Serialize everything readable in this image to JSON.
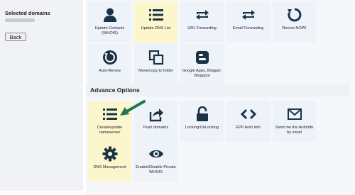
{
  "sidebar": {
    "title": "Selected domains",
    "back_label": "Back"
  },
  "tiles": [
    {
      "label": "Update Contacts (WHOIS)",
      "icon": "user-icon"
    },
    {
      "label": "Update DNS List",
      "icon": "list-icon"
    },
    {
      "label": "URL Forwarding",
      "icon": "forward-arrows-icon"
    },
    {
      "label": "Email Forwarding",
      "icon": "forward-arrows-icon"
    },
    {
      "label": "Renew NOW!",
      "icon": "renew-icon"
    },
    {
      "label": "Auto-Renew",
      "icon": "auto-renew-icon"
    },
    {
      "label": "Move/copy to folder",
      "icon": "copy-icon"
    },
    {
      "label": "Google Apps, Blogger, Blogspot",
      "icon": "blogger-icon"
    }
  ],
  "advance": {
    "title": "Advance Options",
    "tiles": [
      {
        "label": "Create/update nameserver",
        "icon": "list-icon"
      },
      {
        "label": "Push domains",
        "icon": "share-icon"
      },
      {
        "label": "Locking/UnLocking",
        "icon": "lock-icon"
      },
      {
        "label": "EPP Auth Info",
        "icon": "code-icon"
      },
      {
        "label": "Send me the AuthInfo by email",
        "icon": "envelope-icon"
      },
      {
        "label": "DNS Management",
        "icon": "gear-icon"
      },
      {
        "label": "Enable/Disable Private WHOIS",
        "icon": "eye-icon"
      }
    ]
  },
  "colors": {
    "icon": "#1a3346",
    "highlight": "#fcf6cc",
    "tile": "#eef3f9",
    "arrow": "#1d7a4e"
  }
}
